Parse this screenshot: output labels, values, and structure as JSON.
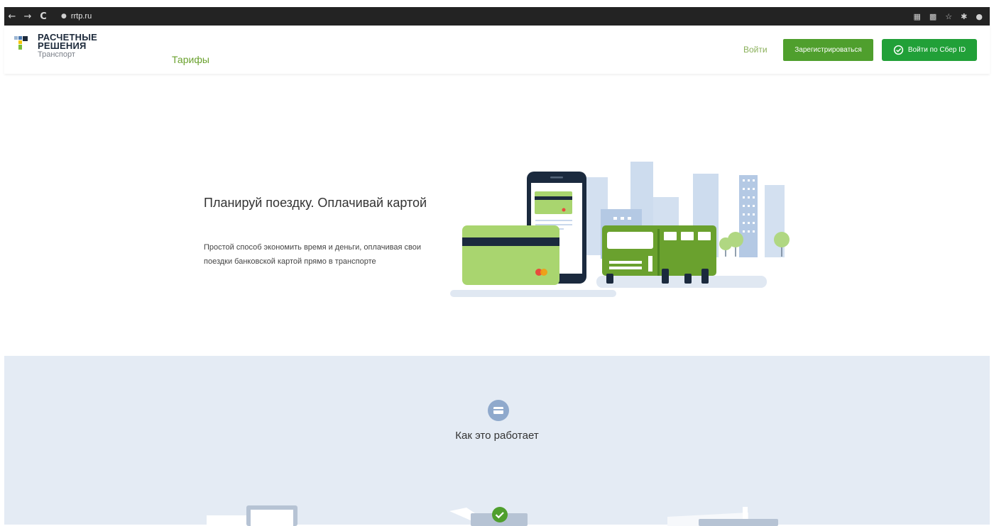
{
  "browser": {
    "url": "rrtp.ru",
    "back": "←",
    "forward": "→",
    "reload": "C"
  },
  "header": {
    "logo": {
      "line1": "РАСЧЕТНЫЕ",
      "line2": "РЕШЕНИЯ",
      "line3": "Транспорт"
    },
    "nav": {
      "tariffs": "Тарифы"
    },
    "login_label": "Войти",
    "register_label": "Зарегистрироваться",
    "sber_label": "Войти по Сбер ID"
  },
  "hero": {
    "title": "Планируй поездку. Оплачивай картой",
    "subtitle": "Простой способ экономить время и деньги, оплачивая свои поездки банковской картой прямо в транспорте"
  },
  "how_it_works": {
    "title": "Как это работает"
  },
  "colors": {
    "brand_green": "#4f9f2d",
    "sber_green": "#21a038",
    "link_green": "#6aa12e",
    "section_bg": "#e4ebf4",
    "chrome_dark": "#232323"
  }
}
